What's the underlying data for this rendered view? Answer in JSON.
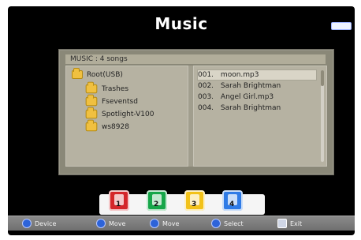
{
  "window": {
    "title": "Music"
  },
  "browser": {
    "header": "MUSIC : 4 songs",
    "folders": {
      "root": "Root(USB)",
      "items": [
        "Trashes",
        "Fseventsd",
        "Spotlight-V100",
        "ws8928"
      ]
    },
    "files": [
      {
        "index": "001.",
        "name": "moon.mp3"
      },
      {
        "index": "002.",
        "name": "Sarah Brightman"
      },
      {
        "index": "003.",
        "name": "Angel Girl.mp3"
      },
      {
        "index": "004.",
        "name": "Sarah Brightman"
      }
    ]
  },
  "color_buttons": [
    {
      "name": "red",
      "number": "1"
    },
    {
      "name": "green",
      "number": "2"
    },
    {
      "name": "yellow",
      "number": "3"
    },
    {
      "name": "blue",
      "number": "4"
    }
  ],
  "footer": {
    "device": "Device",
    "move": "Move",
    "move2": "Move",
    "select": "Select",
    "exit": "Exit"
  },
  "colors": {
    "background": "#000000",
    "panel": "#8a8878",
    "pane": "#b6b2a2",
    "selected_row": "#d9d5c7",
    "red": "#d4262a",
    "green": "#17a64a",
    "yellow": "#f2c21a",
    "blue": "#2f7be6"
  }
}
